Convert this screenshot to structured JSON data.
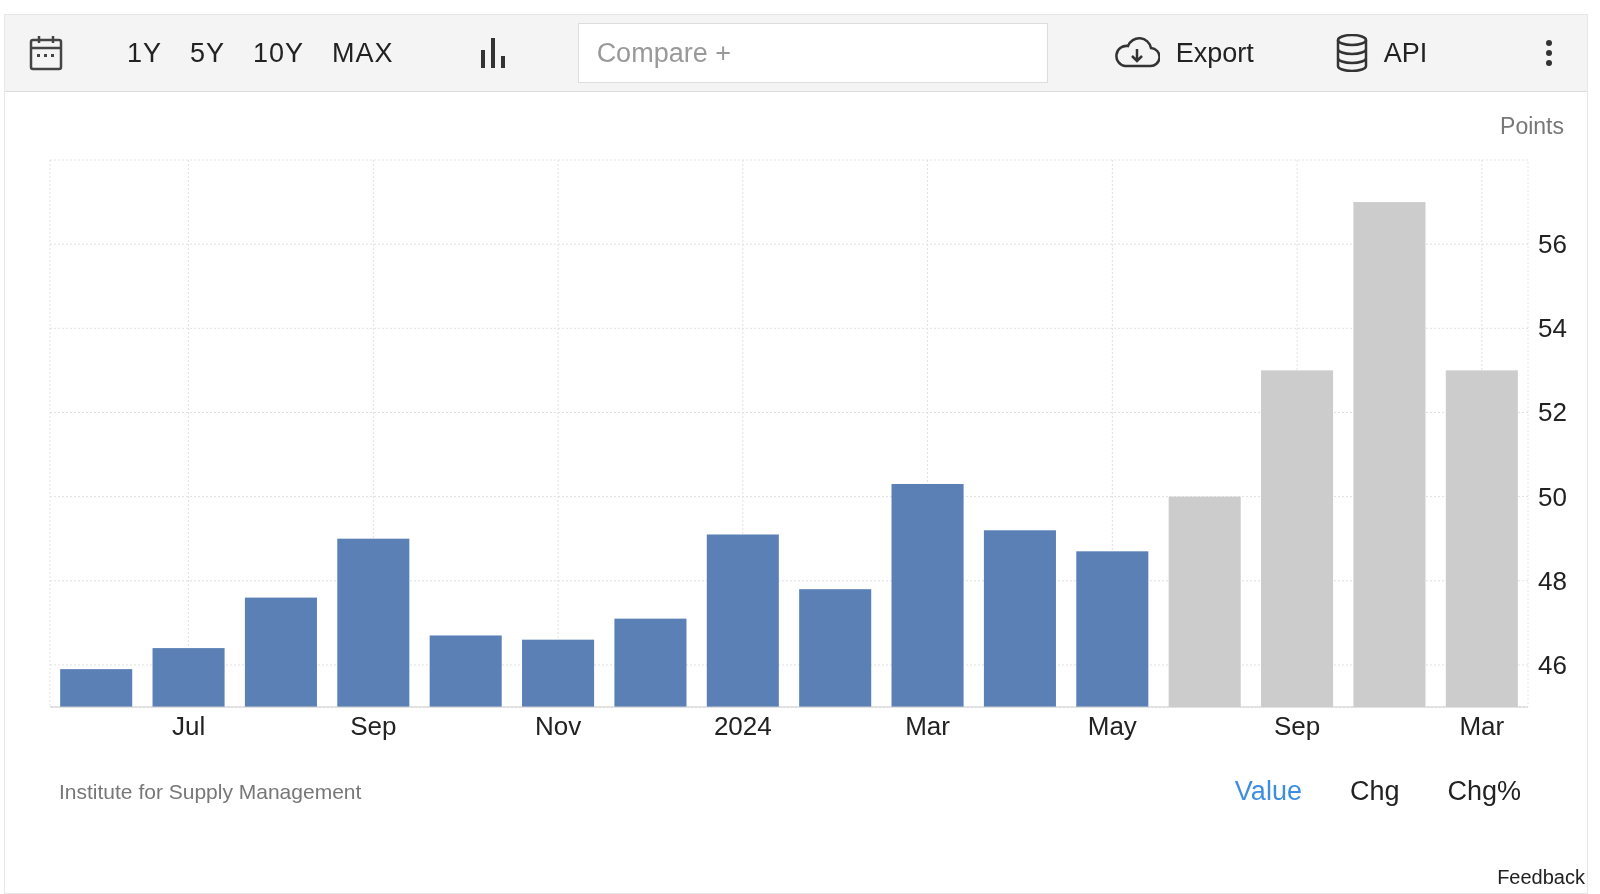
{
  "toolbar": {
    "ranges": [
      "1Y",
      "5Y",
      "10Y",
      "MAX"
    ],
    "compare": {
      "placeholder": "Compare +"
    },
    "export": "Export",
    "api": "API"
  },
  "chart": {
    "chart_data": {
      "type": "bar",
      "ylabel": "Points",
      "categories": [
        null,
        "Jul",
        null,
        "Sep",
        null,
        "Nov",
        null,
        "2024",
        null,
        "Mar",
        null,
        "May",
        null,
        "Sep",
        null,
        "Mar"
      ],
      "series": [
        {
          "color": "#5b80b6",
          "values": [
            45.9,
            46.4,
            47.6,
            49.0,
            46.7,
            46.6,
            47.1,
            49.1,
            47.8,
            50.3,
            49.2,
            48.7,
            null,
            null,
            null,
            null
          ]
        },
        {
          "color": "#cccccc",
          "values": [
            null,
            null,
            null,
            null,
            null,
            null,
            null,
            null,
            null,
            null,
            null,
            null,
            50,
            53,
            57,
            53
          ]
        }
      ],
      "ylim": [
        45,
        58
      ],
      "yticks": [
        46,
        48,
        50,
        52,
        54,
        56
      ],
      "grid": true
    }
  },
  "source": "Institute for Supply Management",
  "tabs": [
    {
      "label": "Value",
      "selected": true
    },
    {
      "label": "Chg",
      "selected": false
    },
    {
      "label": "Chg%",
      "selected": false
    }
  ],
  "feedback": "Feedback"
}
